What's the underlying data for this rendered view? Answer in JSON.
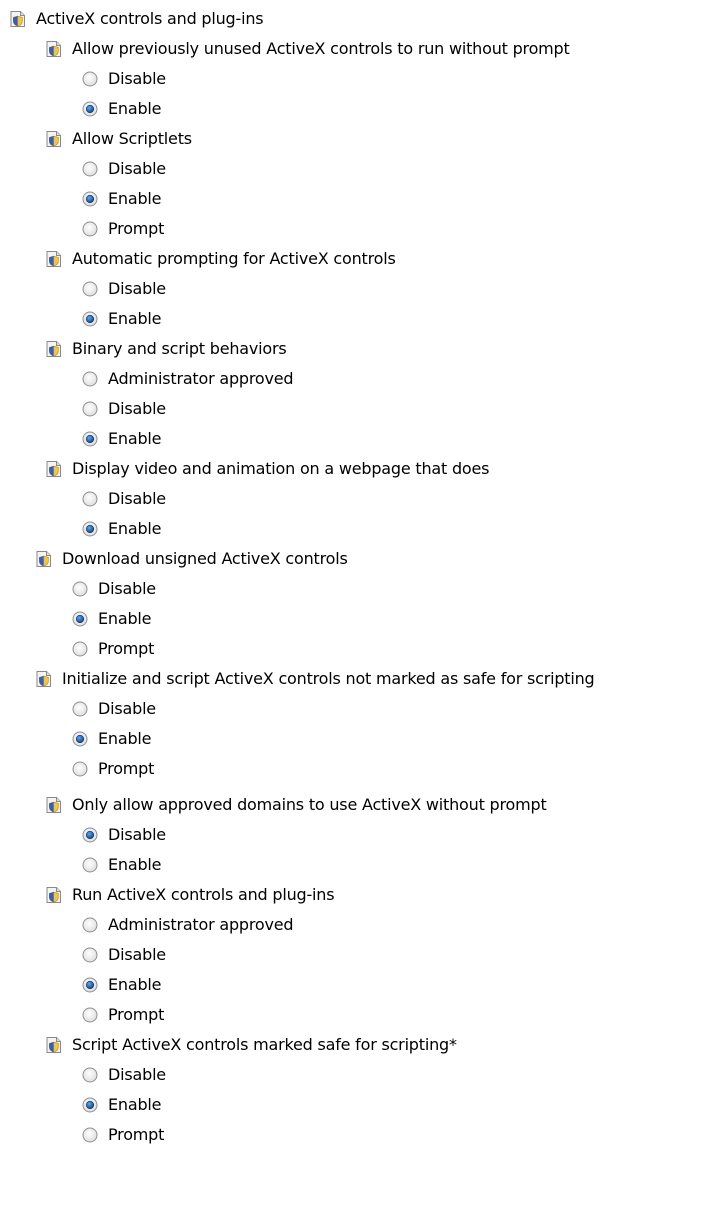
{
  "tree": {
    "root": {
      "label": "ActiveX controls and plug-ins",
      "icon": "shield-settings-icon"
    },
    "settings": [
      {
        "label": "Allow previously unused ActiveX controls to run without prompt",
        "icon": "shield-settings-icon",
        "options": [
          {
            "label": "Disable",
            "selected": false
          },
          {
            "label": "Enable",
            "selected": true
          }
        ]
      },
      {
        "label": "Allow Scriptlets",
        "icon": "shield-settings-icon",
        "options": [
          {
            "label": "Disable",
            "selected": false
          },
          {
            "label": "Enable",
            "selected": true
          },
          {
            "label": "Prompt",
            "selected": false
          }
        ]
      },
      {
        "label": "Automatic prompting for ActiveX controls",
        "icon": "shield-settings-icon",
        "options": [
          {
            "label": "Disable",
            "selected": false
          },
          {
            "label": "Enable",
            "selected": true
          }
        ]
      },
      {
        "label": "Binary and script behaviors",
        "icon": "shield-settings-icon",
        "options": [
          {
            "label": "Administrator approved",
            "selected": false
          },
          {
            "label": "Disable",
            "selected": false
          },
          {
            "label": "Enable",
            "selected": true
          }
        ]
      },
      {
        "label": "Display video and animation on a webpage that does",
        "icon": "shield-settings-icon",
        "options": [
          {
            "label": "Disable",
            "selected": false
          },
          {
            "label": "Enable",
            "selected": true
          }
        ]
      },
      {
        "label": "Download unsigned ActiveX controls",
        "icon": "shield-settings-icon",
        "options": [
          {
            "label": "Disable",
            "selected": false
          },
          {
            "label": "Enable",
            "selected": true
          },
          {
            "label": "Prompt",
            "selected": false
          }
        ]
      },
      {
        "label": "Initialize and script ActiveX controls not marked as safe for scripting",
        "icon": "shield-settings-icon",
        "options": [
          {
            "label": "Disable",
            "selected": false
          },
          {
            "label": "Enable",
            "selected": true
          },
          {
            "label": "Prompt",
            "selected": false
          }
        ]
      },
      {
        "label": "Only allow approved domains to use ActiveX without prompt",
        "icon": "shield-settings-icon",
        "options": [
          {
            "label": "Disable",
            "selected": true
          },
          {
            "label": "Enable",
            "selected": false
          }
        ]
      },
      {
        "label": "Run ActiveX controls and plug-ins",
        "icon": "shield-settings-icon",
        "options": [
          {
            "label": "Administrator approved",
            "selected": false
          },
          {
            "label": "Disable",
            "selected": false
          },
          {
            "label": "Enable",
            "selected": true
          },
          {
            "label": "Prompt",
            "selected": false
          }
        ]
      },
      {
        "label": "Script ActiveX controls marked safe for scripting*",
        "icon": "shield-settings-icon",
        "options": [
          {
            "label": "Disable",
            "selected": false
          },
          {
            "label": "Enable",
            "selected": true
          },
          {
            "label": "Prompt",
            "selected": false
          }
        ]
      }
    ]
  }
}
